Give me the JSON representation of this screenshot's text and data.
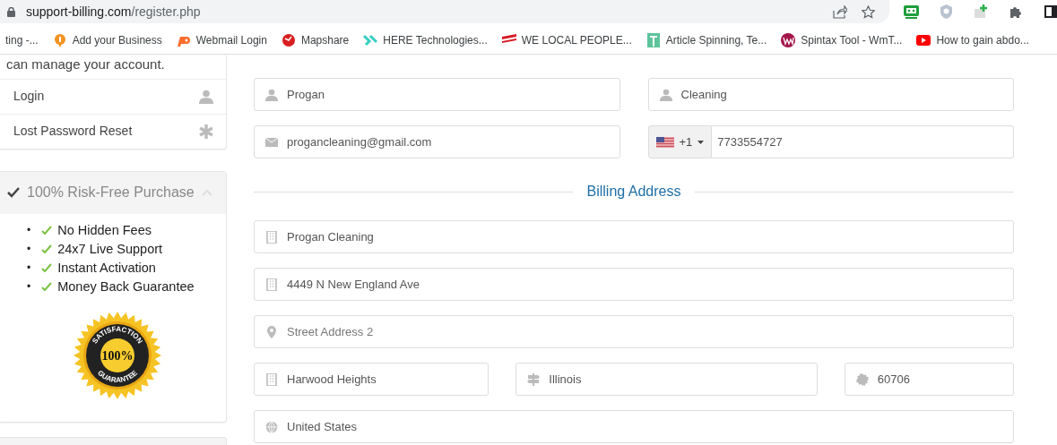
{
  "browser": {
    "url_domain": "support-billing.com",
    "url_path": "/register.php",
    "bookmarks": [
      {
        "label": "ting -..."
      },
      {
        "label": "Add your Business"
      },
      {
        "label": "Webmail Login"
      },
      {
        "label": "Mapshare"
      },
      {
        "label": "HERE Technologies..."
      },
      {
        "label": "WE LOCAL PEOPLE..."
      },
      {
        "label": "Article Spinning, Te..."
      },
      {
        "label": "Spintax Tool - WmT..."
      },
      {
        "label": "How to gain abdo..."
      }
    ]
  },
  "sidebar": {
    "account_card": {
      "text": "can manage your account.",
      "links": [
        {
          "label": "Login"
        },
        {
          "label": "Lost Password Reset"
        }
      ]
    },
    "guarantee_card": {
      "title": "100% Risk-Free Purchase",
      "expanded": true,
      "features": [
        {
          "bullet": "•",
          "label": "No Hidden Fees"
        },
        {
          "bullet": "•",
          "label": "24x7 Live Support"
        },
        {
          "bullet": "•",
          "label": "Instant Activation"
        },
        {
          "bullet": "•",
          "label": "Money Back Guarantee"
        }
      ],
      "seal": {
        "top": "SATISFACTION",
        "middle": "100%",
        "bottom": "GUARANTEE"
      }
    }
  },
  "form": {
    "personal_rows": [
      [
        {
          "kind": "person",
          "value": "Progan"
        },
        {
          "kind": "person",
          "value": "Cleaning"
        }
      ],
      [
        {
          "kind": "email",
          "value": "progancleaning@gmail.com"
        },
        {
          "kind": "phone",
          "country_code": "+1",
          "value": "7733554727"
        }
      ]
    ],
    "billing_heading": "Billing Address",
    "billing_rows": [
      [
        {
          "kind": "company",
          "value": "Progan Cleaning"
        }
      ],
      [
        {
          "kind": "address",
          "value": "4449 N New England Ave"
        }
      ],
      [
        {
          "kind": "address2",
          "placeholder": "Street Address 2"
        }
      ],
      [
        {
          "kind": "city",
          "value": "Harwood Heights"
        },
        {
          "kind": "state",
          "value": "Illinois"
        },
        {
          "kind": "postcode",
          "value": "60706"
        }
      ],
      [
        {
          "kind": "country",
          "value": "United States"
        }
      ]
    ]
  }
}
